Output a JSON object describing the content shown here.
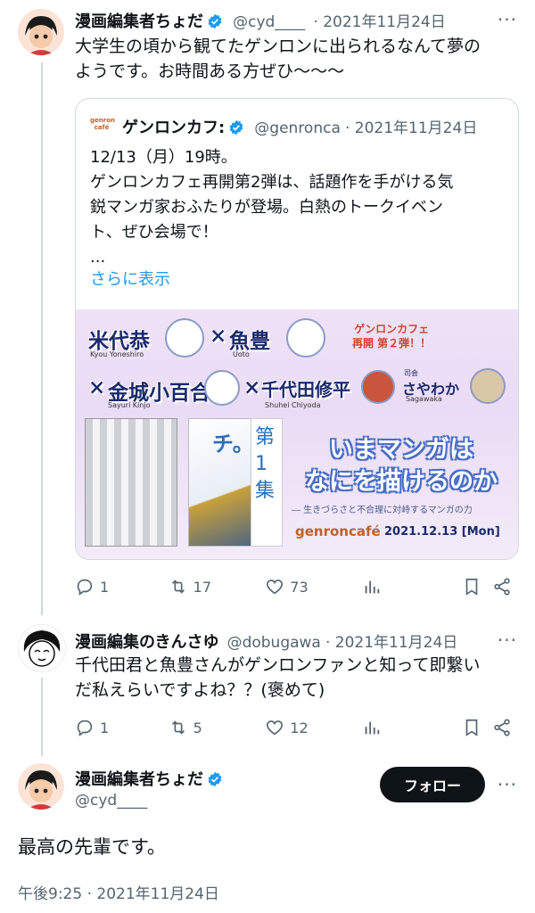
{
  "tweet1": {
    "name": "漫画編集者ちょだ",
    "handle": "@cyd____",
    "date": "· 2021年11月24日",
    "text_line1": "大学生の頃から観てたゲンロンに出られるなんて夢の",
    "text_line2": "ようです。お時間ある方ぜひ〜〜〜",
    "quote": {
      "logo_top": "genron",
      "logo_bottom": "café",
      "name": "ゲンロンカフ:",
      "handle": "@genronca",
      "date": "· 2021年11月24日",
      "line1": "12/13（月）19時。",
      "line2": "ゲンロンカフェ再開第2弾は、話題作を手がける気",
      "line3": "鋭マンガ家おふたりが登場。白熱のトークイベン",
      "line4": "ト、ぜひ会場で！",
      "ellipsis": "...",
      "show_more": "さらに表示",
      "banner": {
        "guest1": "米代恭",
        "guest1_en": "Kyou Yoneshiro",
        "x1": "×",
        "guest2": "魚豊",
        "guest2_en": "Uoto",
        "x2": "×",
        "guest3": "金城小百合",
        "guest3_en": "Sayuri Kinjo",
        "x3": "×",
        "guest4": "千代田修平",
        "guest4_en": "Shuhei Chiyoda",
        "moderator_label": "司会",
        "moderator": "さやわか",
        "moderator_en": "Sagawaka",
        "tag_line1": "ゲンロンカフェ",
        "tag_line2": "再開 第２弾！！",
        "book2_char": "チ。",
        "book3_text": "第1集",
        "headline1": "いまマンガは",
        "headline2": "なにを描けるのか",
        "subline": "― 生きづらさと不合理に対峙するマンガの力",
        "brand": "genroncafé",
        "event_date": "2021.12.13 [Mon]"
      }
    },
    "actions": {
      "reply": "1",
      "retweet": "17",
      "like": "73"
    }
  },
  "tweet2": {
    "name": "漫画編集のきんさゆ",
    "handle": "@dobugawa",
    "date": "· 2021年11月24日",
    "text_line1": "千代田君と魚豊さんがゲンロンファンと知って即繋い",
    "text_line2": "だ私えらいですよね？？(褒めて)",
    "actions": {
      "reply": "1",
      "retweet": "5",
      "like": "12"
    }
  },
  "main": {
    "name": "漫画編集者ちょだ",
    "handle": "@cyd____",
    "follow": "フォロー",
    "text": "最高の先輩です。",
    "timestamp": "午後9:25 · 2021年11月24日"
  },
  "colors": {
    "verified": "#1d9bf0",
    "link": "#1d9bf0",
    "text": "#0f1419",
    "muted": "#536471"
  }
}
